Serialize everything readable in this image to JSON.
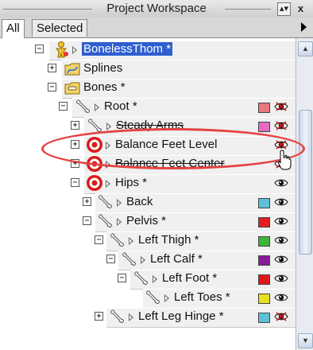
{
  "window": {
    "title": "Project Workspace",
    "pin_button": "▴▾",
    "close_button": "x"
  },
  "tabs": [
    {
      "label": "All",
      "active": true
    },
    {
      "label": "Selected",
      "active": false
    }
  ],
  "tree": {
    "rows": [
      {
        "label": "BonelessThom *",
        "icon": "character-icon",
        "expander": "−",
        "has_play": true,
        "selected": true
      },
      {
        "label": "Splines",
        "icon": "splines-folder-icon",
        "expander": "+",
        "has_play": false
      },
      {
        "label": "Bones *",
        "icon": "bones-folder-icon",
        "expander": "−",
        "has_play": false
      },
      {
        "label": "Root *",
        "icon": "bone-icon",
        "expander": "−",
        "has_play": true,
        "color": "#e8787f",
        "eye": "crossed"
      },
      {
        "label": "Steady Arms",
        "icon": "bone-icon",
        "expander": "+",
        "has_play": true,
        "color": "#e86ac2",
        "eye": "crossed",
        "strikethrough": true
      },
      {
        "label": "Balance Feet Level",
        "icon": "target-icon",
        "expander": "+",
        "has_play": true,
        "eye": "crossed"
      },
      {
        "label": "Balance Feet Center",
        "icon": "target-icon",
        "expander": "+",
        "has_play": true,
        "eye": "crossed",
        "strikethrough": true
      },
      {
        "label": "Hips *",
        "icon": "target-icon",
        "expander": "−",
        "has_play": true,
        "eye": "open"
      },
      {
        "label": "Back",
        "icon": "bone-icon",
        "expander": "+",
        "has_play": true,
        "color": "#5ec0d8",
        "eye": "open"
      },
      {
        "label": "Pelvis *",
        "icon": "bone-icon",
        "expander": "−",
        "has_play": true,
        "color": "#e02020",
        "eye": "open"
      },
      {
        "label": "Left Thigh *",
        "icon": "bone-icon",
        "expander": "−",
        "has_play": true,
        "color": "#3cb43c",
        "eye": "open"
      },
      {
        "label": "Left Calf *",
        "icon": "bone-icon",
        "expander": "−",
        "has_play": true,
        "color": "#8a1a9a",
        "eye": "open"
      },
      {
        "label": "Left Foot *",
        "icon": "bone-icon",
        "expander": "−",
        "has_play": true,
        "color": "#e01818",
        "eye": "open"
      },
      {
        "label": "Left Toes *",
        "icon": "bone-icon",
        "expander": "",
        "has_play": true,
        "color": "#e8e020",
        "eye": "open"
      },
      {
        "label": "Left Leg Hinge *",
        "icon": "bone-icon",
        "expander": "+",
        "has_play": true,
        "color": "#5ec0d8",
        "eye": "crossed"
      }
    ]
  }
}
